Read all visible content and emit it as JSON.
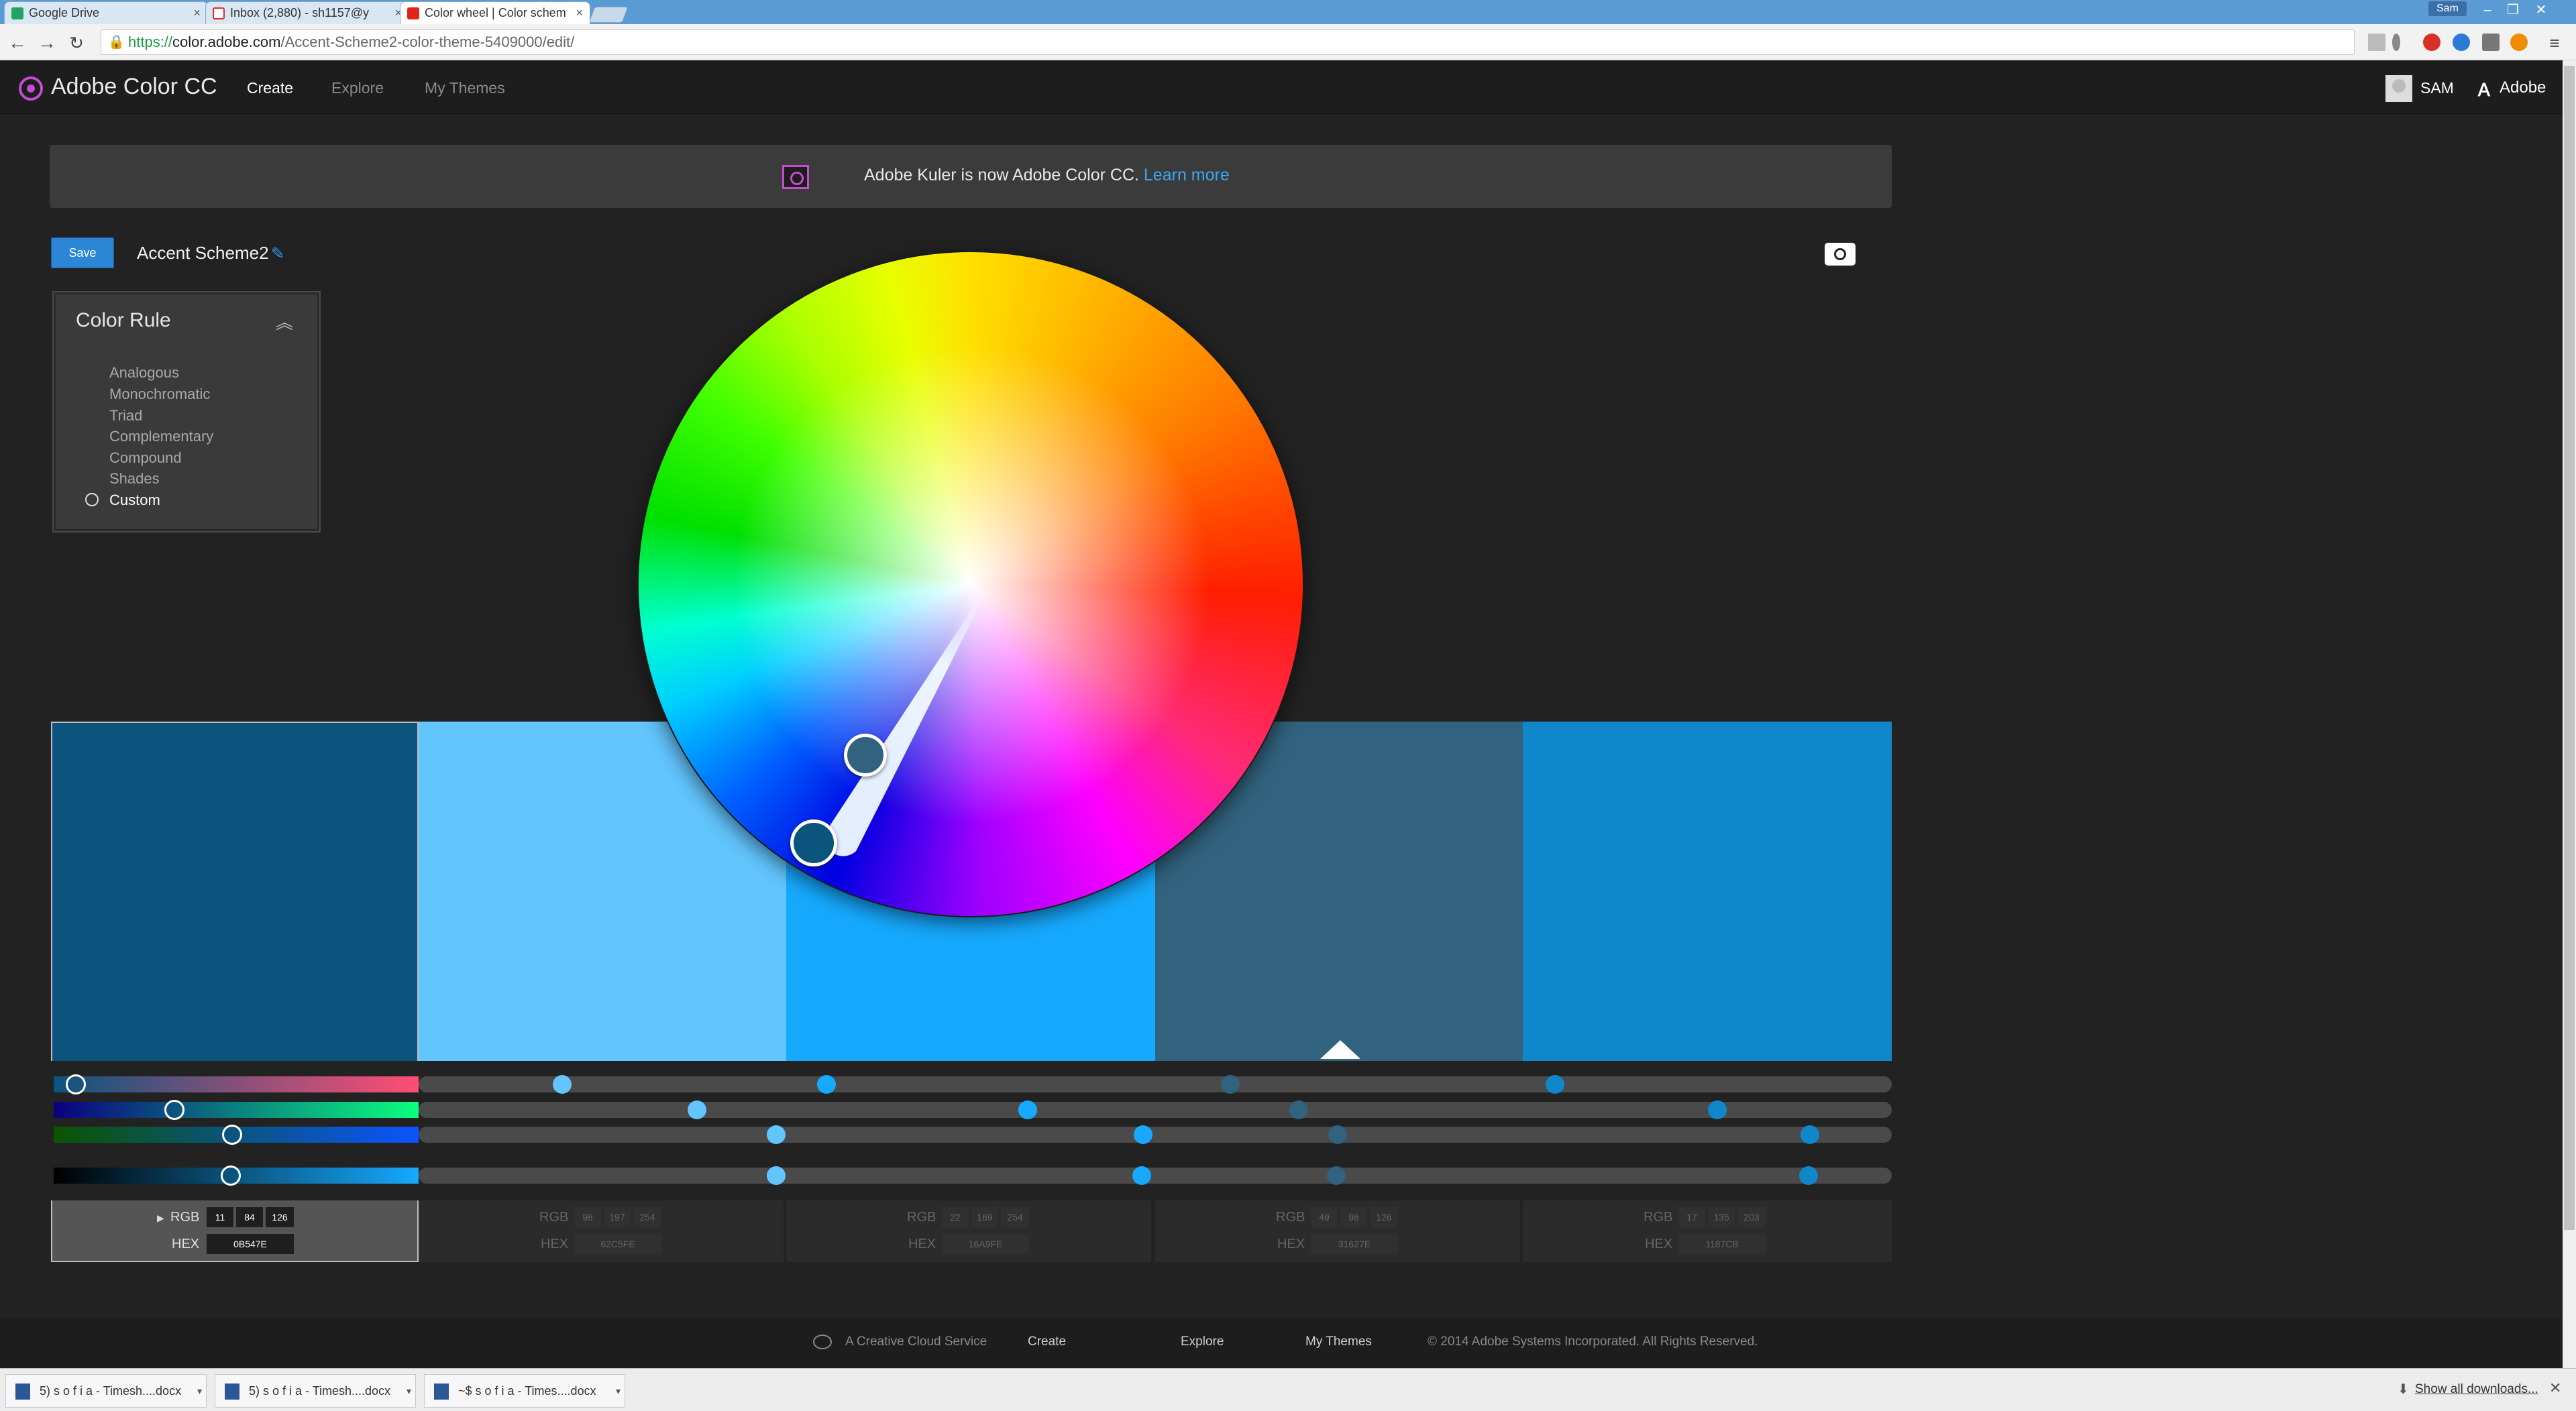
{
  "browser": {
    "tabs": [
      {
        "title": "Google Drive",
        "favicon_color": "#1fa463"
      },
      {
        "title": "Inbox (2,880) - sh1157@y",
        "favicon_color": "#d93025"
      },
      {
        "title": "Color wheel | Color schem",
        "favicon_color": "#e1251b"
      }
    ],
    "window_user": "Sam",
    "url_scheme": "https://",
    "url_host": "color.adobe.com",
    "url_path": "/Accent-Scheme2-color-theme-5409000/edit/"
  },
  "header": {
    "brand": "Adobe Color CC",
    "nav": [
      "Create",
      "Explore",
      "My Themes"
    ],
    "user": "SAM",
    "adobe": "Adobe"
  },
  "banner": {
    "text": "Adobe Kuler is now Adobe Color CC.",
    "link": "Learn more"
  },
  "toolbar": {
    "save_label": "Save",
    "theme_name": "Accent Scheme2"
  },
  "color_rule": {
    "title": "Color Rule",
    "items": [
      "Analogous",
      "Monochromatic",
      "Triad",
      "Complementary",
      "Compound",
      "Shades",
      "Custom"
    ],
    "selected": "Custom"
  },
  "swatches": [
    {
      "hex": "#0B547E",
      "rgb": [
        "11",
        "84",
        "126"
      ],
      "hex_label": "0B547E",
      "selected": true
    },
    {
      "hex": "#62C5FE",
      "rgb": [
        "98",
        "197",
        "254"
      ],
      "hex_label": "62C5FE",
      "selected": false
    },
    {
      "hex": "#16A9FE",
      "rgb": [
        "22",
        "169",
        "254"
      ],
      "hex_label": "16A9FE",
      "selected": false
    },
    {
      "hex": "#31627E",
      "rgb": [
        "49",
        "98",
        "126"
      ],
      "hex_label": "31627E",
      "selected": false
    },
    {
      "hex": "#1187CB",
      "rgb": [
        "17",
        "135",
        "203"
      ],
      "hex_label": "1187CB",
      "selected": false
    }
  ],
  "value_labels": {
    "rgb": "RGB",
    "hex": "HEX"
  },
  "footer": {
    "service": "A Creative Cloud Service",
    "links": [
      "Create",
      "Explore",
      "My Themes"
    ],
    "copyright": "© 2014 Adobe Systems Incorporated. All Rights Reserved."
  },
  "downloads": {
    "items": [
      "5) s o f i a - Timesh....docx",
      "5) s o f i a - Timesh....docx",
      "~$ s o f i a - Times....docx"
    ],
    "show_all": "Show all downloads..."
  }
}
